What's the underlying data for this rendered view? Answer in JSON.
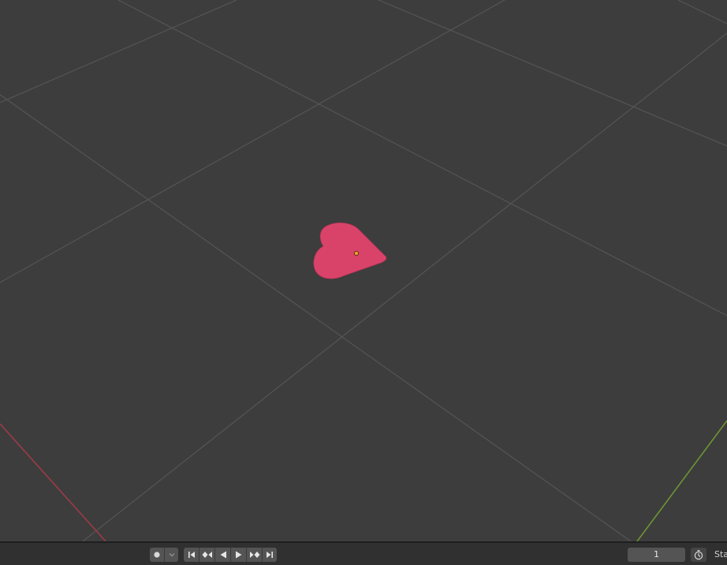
{
  "timeline": {
    "current_frame": "1",
    "start_label": "Start",
    "keyframe_type": "dot",
    "controls": [
      "jump-to-start",
      "jump-to-previous-keyframe",
      "play-reverse",
      "play",
      "jump-to-next-keyframe",
      "jump-to-end"
    ]
  },
  "colors": {
    "viewport_bg": "#3d3d3d",
    "grid_line": "#555555",
    "x_axis": "#9c3b48",
    "y_axis": "#6e9533",
    "heart_fill": "#d9436a",
    "origin_dot": "#f2a31f"
  }
}
